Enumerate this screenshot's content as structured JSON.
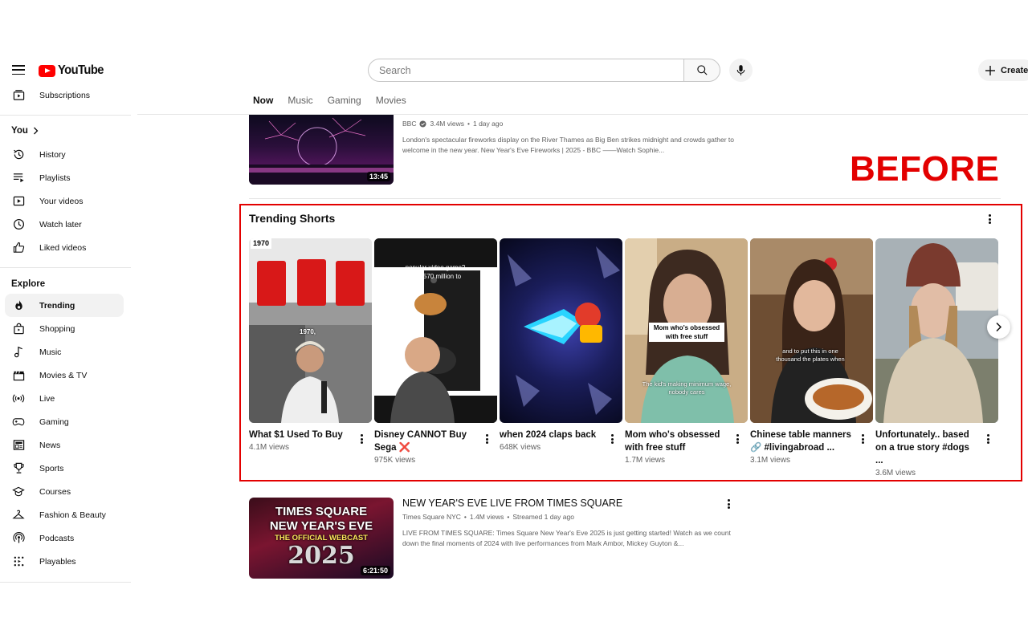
{
  "header": {
    "logo_text": "YouTube",
    "search_placeholder": "Search",
    "create_label": "Create"
  },
  "chips": [
    "Now",
    "Music",
    "Gaming",
    "Movies"
  ],
  "sidebar": {
    "subscriptions": "Subscriptions",
    "you_label": "You",
    "you_items": [
      "History",
      "Playlists",
      "Your videos",
      "Watch later",
      "Liked videos"
    ],
    "explore_label": "Explore",
    "explore_items": [
      "Trending",
      "Shopping",
      "Music",
      "Movies & TV",
      "Live",
      "Gaming",
      "News",
      "Sports",
      "Courses",
      "Fashion & Beauty",
      "Podcasts",
      "Playables"
    ]
  },
  "video1": {
    "channel": "BBC",
    "views": "3.4M views",
    "age": "1 day ago",
    "description": "London's spectacular fireworks display on the River Thames as Big Ben strikes midnight and crowds gather to welcome in the new year. New Year's Eve Fireworks | 2025 - BBC ——Watch Sophie...",
    "duration": "13:45"
  },
  "annotation": {
    "label": "BEFORE",
    "color": "#e30000"
  },
  "shorts": {
    "section_title": "Trending Shorts",
    "items": [
      {
        "title": "What $1 Used To Buy",
        "views": "4.1M views",
        "overlay": "1970,",
        "corner": "1970"
      },
      {
        "title": "Disney CANNOT Buy Sega ❌",
        "views": "975K views",
        "overlay": "popular video game? cost 570 million to"
      },
      {
        "title": "when 2024 claps back",
        "views": "648K views"
      },
      {
        "title": "Mom who's obsessed with free stuff",
        "views": "1.7M views",
        "overlay": "Mom who's obsessed with free stuff",
        "overlay2": "The kid's making minimum wage, nobody cares"
      },
      {
        "title": "Chinese table manners 🔗 #livingabroad ...",
        "views": "3.1M views",
        "overlay": "and to put this in one thousand the plates when"
      },
      {
        "title": "Unfortunately.. based on a true story #dogs ...",
        "views": "3.6M views"
      }
    ]
  },
  "video2": {
    "title": "NEW YEAR'S EVE LIVE FROM TIMES SQUARE",
    "channel": "Times Square NYC",
    "views": "1.4M views",
    "age": "Streamed 1 day ago",
    "description": "LIVE FROM TIMES SQUARE: Times Square New Year's Eve 2025 is just getting started! Watch as we count down the final moments of 2024 with live performances from Mark Ambor, Mickey Guyton &...",
    "duration": "6:21:50",
    "thumb_lines": [
      "TIMES SQUARE",
      "NEW YEAR'S EVE",
      "THE OFFICIAL WEBCAST",
      "2025"
    ]
  }
}
